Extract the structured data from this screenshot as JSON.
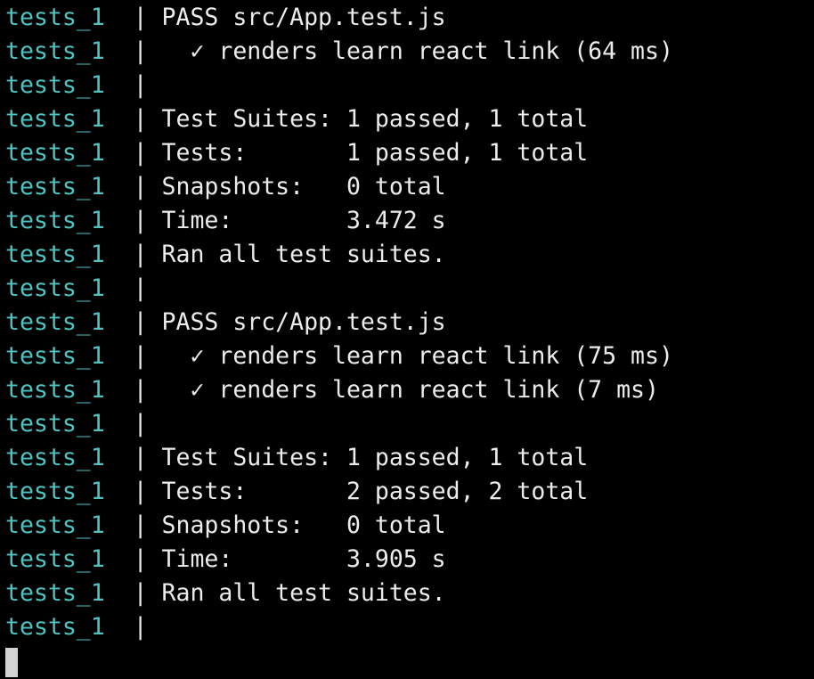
{
  "terminal": {
    "prefix": "tests_1",
    "separator": "|",
    "prefix_color": "#4fc4c0",
    "text_color": "#ececec",
    "background": "#000000",
    "lines": [
      "PASS src/App.test.js",
      "  ✓ renders learn react link (64 ms)",
      "",
      "Test Suites: 1 passed, 1 total",
      "Tests:       1 passed, 1 total",
      "Snapshots:   0 total",
      "Time:        3.472 s",
      "Ran all test suites.",
      "",
      "PASS src/App.test.js",
      "  ✓ renders learn react link (75 ms)",
      "  ✓ renders learn react link (7 ms)",
      "",
      "Test Suites: 1 passed, 1 total",
      "Tests:       2 passed, 2 total",
      "Snapshots:   0 total",
      "Time:        3.905 s",
      "Ran all test suites.",
      ""
    ]
  }
}
